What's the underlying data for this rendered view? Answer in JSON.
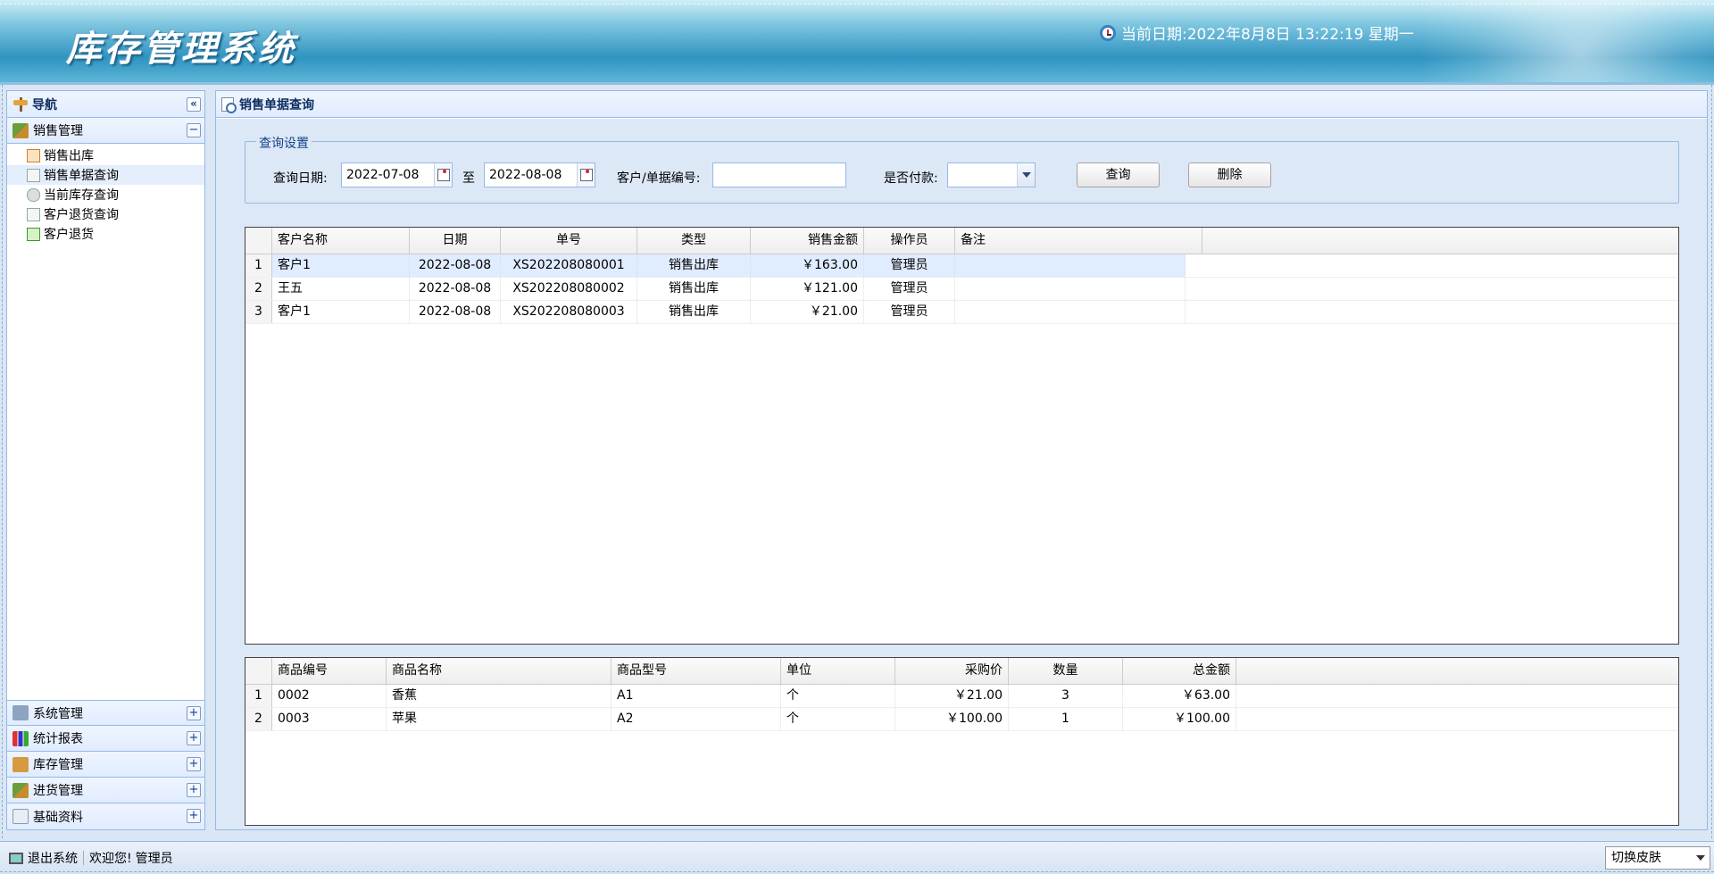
{
  "header": {
    "title": "库存管理系统",
    "date_label": "当前日期:",
    "date_value": "2022年8月8日 13:22:19 星期一"
  },
  "nav": {
    "title": "导航",
    "collapse_glyph": "«",
    "sections": [
      {
        "label": "销售管理",
        "tool": "−",
        "expanded": true
      },
      {
        "label": "系统管理",
        "tool": "+"
      },
      {
        "label": "统计报表",
        "tool": "+"
      },
      {
        "label": "库存管理",
        "tool": "+"
      },
      {
        "label": "进货管理",
        "tool": "+"
      },
      {
        "label": "基础资料",
        "tool": "+"
      }
    ],
    "sales_items": [
      "销售出库",
      "销售单据查询",
      "当前库存查询",
      "客户退货查询",
      "客户退货"
    ]
  },
  "main": {
    "title": "销售单据查询",
    "query": {
      "legend": "查询设置",
      "date_label": "查询日期:",
      "date_from": "2022-07-08",
      "to_label": "至",
      "date_to": "2022-08-08",
      "customer_label": "客户/单据编号:",
      "customer_value": "",
      "paid_label": "是否付款:",
      "paid_value": "",
      "search_button": "查询",
      "delete_button": "删除"
    },
    "orders": {
      "columns": [
        "客户名称",
        "日期",
        "单号",
        "类型",
        "销售金额",
        "操作员",
        "备注"
      ],
      "rows": [
        {
          "num": "1",
          "customer": "客户1",
          "date": "2022-08-08",
          "order_no": "XS202208080001",
          "type": "销售出库",
          "amount": "￥163.00",
          "operator": "管理员",
          "note": ""
        },
        {
          "num": "2",
          "customer": "王五",
          "date": "2022-08-08",
          "order_no": "XS202208080002",
          "type": "销售出库",
          "amount": "￥121.00",
          "operator": "管理员",
          "note": ""
        },
        {
          "num": "3",
          "customer": "客户1",
          "date": "2022-08-08",
          "order_no": "XS202208080003",
          "type": "销售出库",
          "amount": "￥21.00",
          "operator": "管理员",
          "note": ""
        }
      ]
    },
    "items": {
      "columns": [
        "商品编号",
        "商品名称",
        "商品型号",
        "单位",
        "采购价",
        "数量",
        "总金额"
      ],
      "rows": [
        {
          "num": "1",
          "code": "0002",
          "name": "香蕉",
          "model": "A1",
          "unit": "个",
          "price": "￥21.00",
          "qty": "3",
          "total": "￥63.00"
        },
        {
          "num": "2",
          "code": "0003",
          "name": "苹果",
          "model": "A2",
          "unit": "个",
          "price": "￥100.00",
          "qty": "1",
          "total": "￥100.00"
        }
      ]
    }
  },
  "footer": {
    "logout": "退出系统",
    "welcome": "欢迎您!",
    "user": "管理员",
    "skin": "切换皮肤"
  }
}
